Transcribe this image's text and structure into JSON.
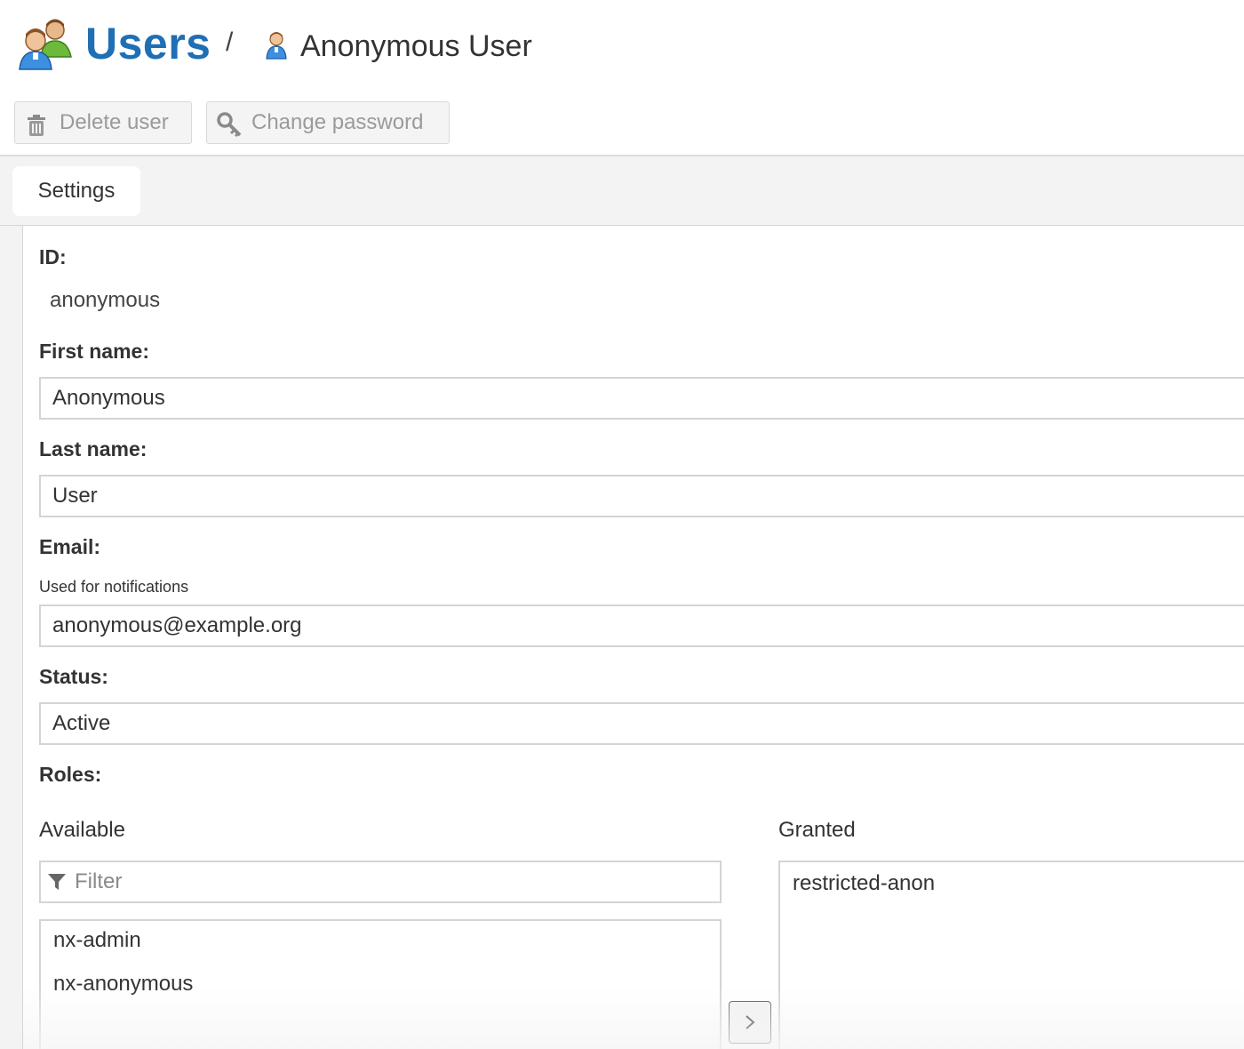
{
  "header": {
    "section_title": "Users",
    "separator": "/",
    "current_user": "Anonymous User"
  },
  "toolbar": {
    "delete_label": "Delete user",
    "change_password_label": "Change password"
  },
  "tabs": [
    {
      "label": "Settings",
      "active": true
    }
  ],
  "form": {
    "id_label": "ID:",
    "id_value": "anonymous",
    "first_name_label": "First name:",
    "first_name_value": "Anonymous",
    "last_name_label": "Last name:",
    "last_name_value": "User",
    "email_label": "Email:",
    "email_help": "Used for notifications",
    "email_value": "anonymous@example.org",
    "status_label": "Status:",
    "status_value": "Active",
    "roles_label": "Roles:"
  },
  "roles": {
    "available_label": "Available",
    "granted_label": "Granted",
    "filter_placeholder": "Filter",
    "available": [
      "nx-admin",
      "nx-anonymous"
    ],
    "granted": [
      "restricted-anon"
    ]
  },
  "colors": {
    "accent": "#1f6fb5",
    "border": "#d4d4d4",
    "toolbar_disabled_text": "#9a9a9a"
  },
  "icons": {
    "section": "users-group-icon",
    "current": "user-icon",
    "delete": "trash-icon",
    "password": "key-icon",
    "filter": "filter-icon",
    "move": "chevron-right-icon"
  }
}
